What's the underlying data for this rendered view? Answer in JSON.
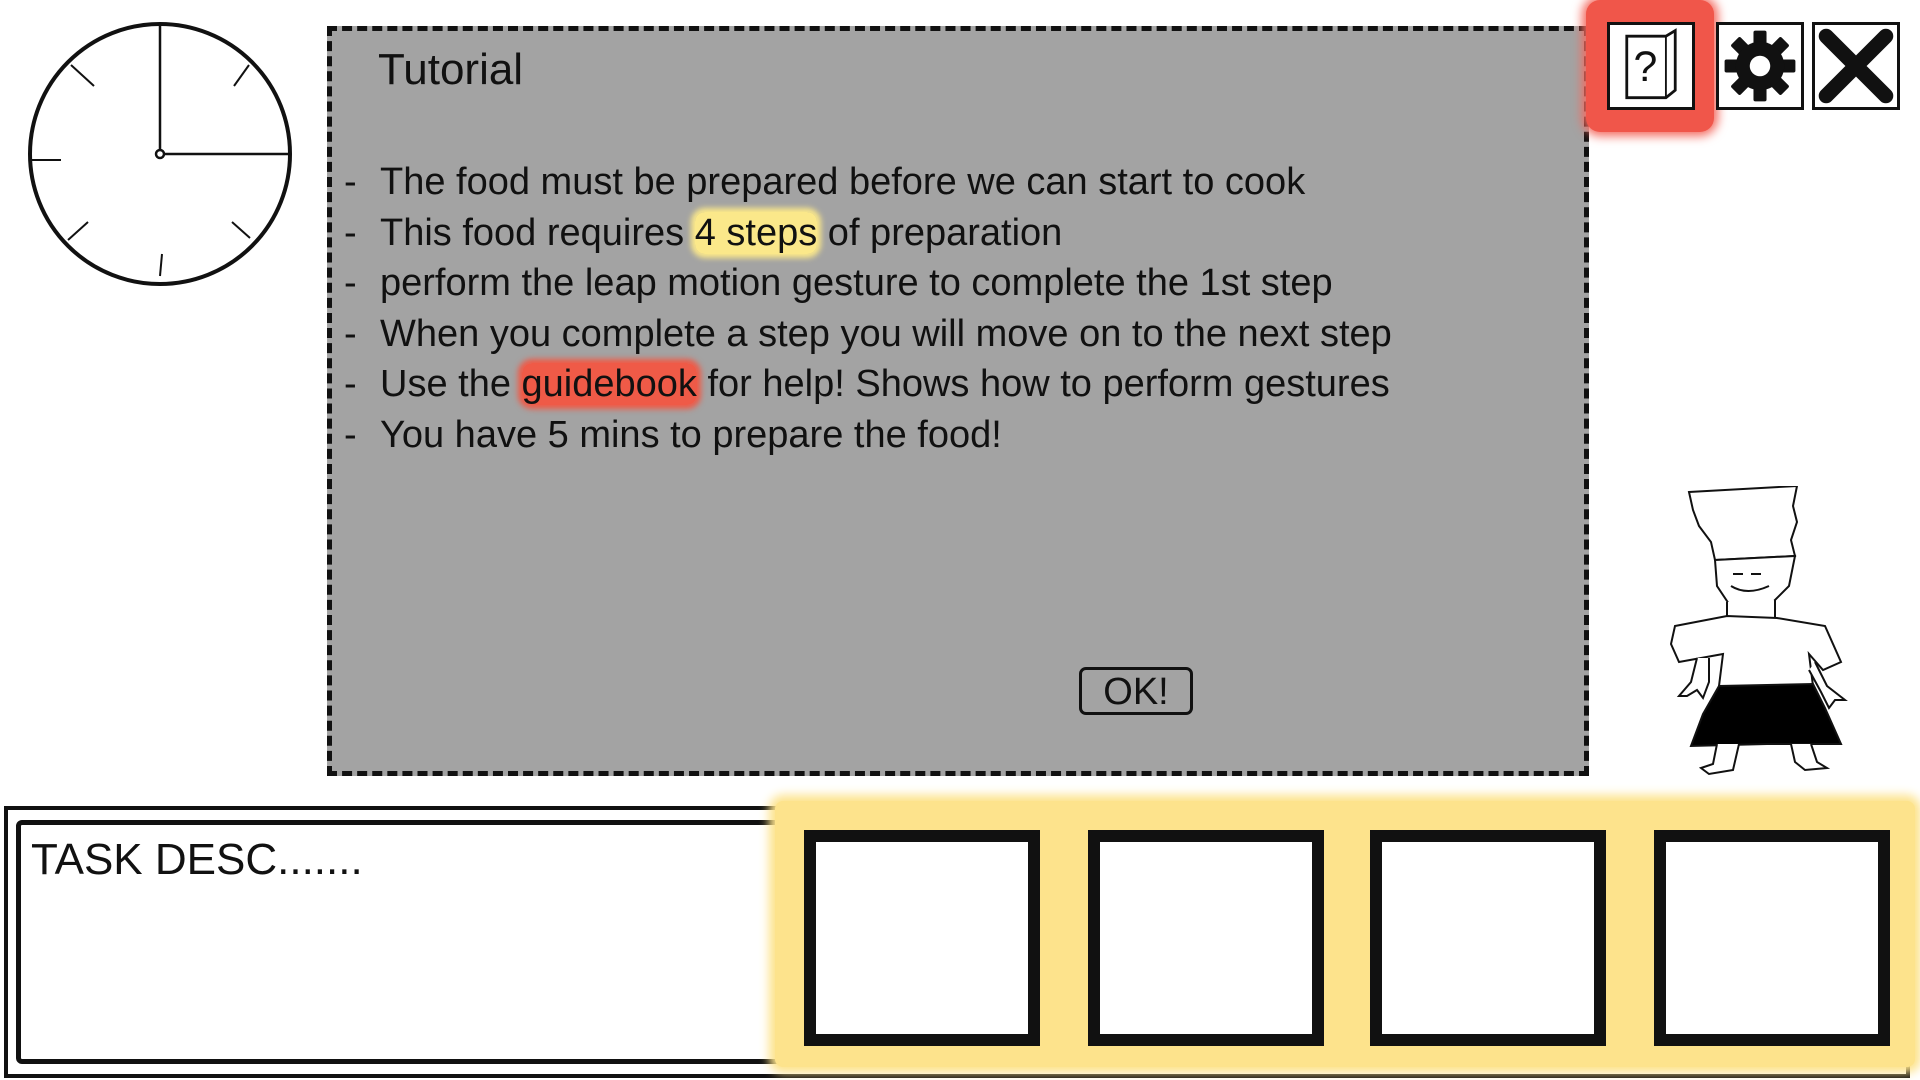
{
  "dialog": {
    "title": "Tutorial",
    "items": [
      {
        "dash": "-",
        "text": "The food must be prepared before we can start to cook"
      },
      {
        "dash": "-",
        "pre": "This food requires ",
        "highlight": "4 steps",
        "post": " of preparation"
      },
      {
        "dash": "-",
        "text": "perform the leap motion gesture to complete the 1st step"
      },
      {
        "dash": "-",
        "text": "When you complete a step you will move on to the next step"
      },
      {
        "dash": "-",
        "pre": "Use the ",
        "highlight": "guidebook",
        "post": " for help! Shows how to perform gestures"
      },
      {
        "dash": "-",
        "text": "You have 5 mins to prepare the food!"
      }
    ],
    "ok_label": "OK!"
  },
  "toolbar": {
    "help_icon": "guidebook-question-icon",
    "settings_icon": "gear-icon",
    "close_icon": "close-icon"
  },
  "task": {
    "description": "TASK DESC......."
  },
  "steps": {
    "slot_count_label": "4 steps"
  },
  "colors": {
    "dialog_bg": "#a3a3a3",
    "highlight_yellow": "#fbe88a",
    "highlight_red": "#ef5a47"
  }
}
